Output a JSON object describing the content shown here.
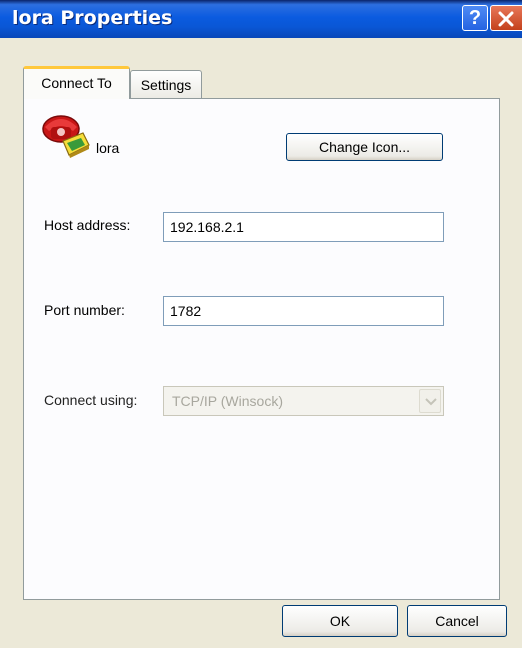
{
  "window": {
    "title": "lora Properties",
    "help_glyph": "?",
    "title_gradient": [
      "#0a246a",
      "#0b5be0"
    ],
    "close_color": "#d5532e"
  },
  "tabs": [
    {
      "label": "Connect To",
      "selected": true
    },
    {
      "label": "Settings",
      "selected": false
    }
  ],
  "connection": {
    "name": "lora",
    "icon": "telephone-connection-icon",
    "change_icon_label": "Change Icon..."
  },
  "form": {
    "host_label": "Host address:",
    "host_value": "192.168.2.1",
    "port_label": "Port number:",
    "port_value": "1782",
    "connect_label": "Connect using:",
    "connect_value": "TCP/IP (Winsock)",
    "connect_disabled": true
  },
  "buttons": {
    "ok": "OK",
    "cancel": "Cancel"
  }
}
